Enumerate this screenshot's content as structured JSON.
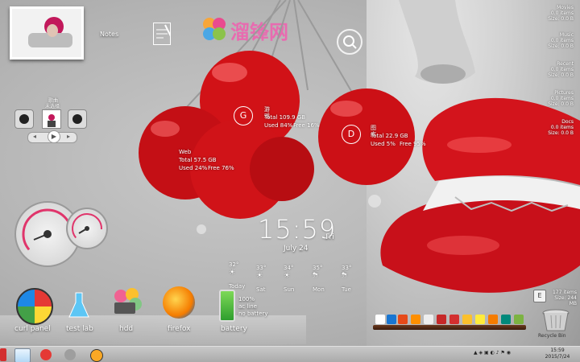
{
  "watermark": {
    "text": "溜锋网"
  },
  "notes": {
    "label": "Notes"
  },
  "music": {
    "title": "歌曲",
    "subtitle": "未选择"
  },
  "weather_sphere_1": {
    "symbol": "G",
    "name": "游戏",
    "total": "Total 109.9 GB",
    "used": "Used 84%",
    "free": "Free 16%"
  },
  "weather_sphere_2": {
    "symbol": "D",
    "name": "图库",
    "total": "Total 22.9 GB",
    "used": "Used 5%",
    "free": "Free 95%"
  },
  "weather_sphere_3": {
    "symbol": "",
    "name": "Web",
    "total": "Total 57.5 GB",
    "used": "Used 24%",
    "free": "Free 76%"
  },
  "clock": {
    "time": "15:59",
    "day": "Fri",
    "date": "July 24"
  },
  "forecast": [
    {
      "temp": "32°",
      "day": "Today"
    },
    {
      "temp": "33°",
      "day": "Sat"
    },
    {
      "temp": "34°",
      "day": "Sun"
    },
    {
      "temp": "35°",
      "day": "Mon"
    },
    {
      "temp": "33°",
      "day": "Tue"
    }
  ],
  "dock": [
    {
      "label": "curl panel"
    },
    {
      "label": "test lab"
    },
    {
      "label": "hdd"
    },
    {
      "label": "firefox"
    },
    {
      "label": "battery"
    }
  ],
  "battery": {
    "line1": "100%",
    "line2": "ac line",
    "line3": "no battery"
  },
  "folders": [
    {
      "name": "Movies",
      "items": "0.0 items",
      "size": "Size: 0.0 B"
    },
    {
      "name": "Music",
      "items": "0.0 items",
      "size": "Size: 0.0 B"
    },
    {
      "name": "Recent",
      "items": "0.0 items",
      "size": "Size: 0.0 B"
    },
    {
      "name": "Pictures",
      "items": "0.0 items",
      "size": "Size: 0.0 B"
    },
    {
      "name": "Docs",
      "items": "0.0 items",
      "size": "Size: 0.0 B"
    }
  ],
  "recycle": {
    "letter": "E",
    "count": "177 items",
    "size": "Size: 244 MB",
    "label": "Recycle Bin"
  },
  "tray": {
    "time": "15:59",
    "date": "2015/7/24"
  },
  "colors": {
    "accent": "#d61a1f",
    "gauge": "#e0356b"
  }
}
